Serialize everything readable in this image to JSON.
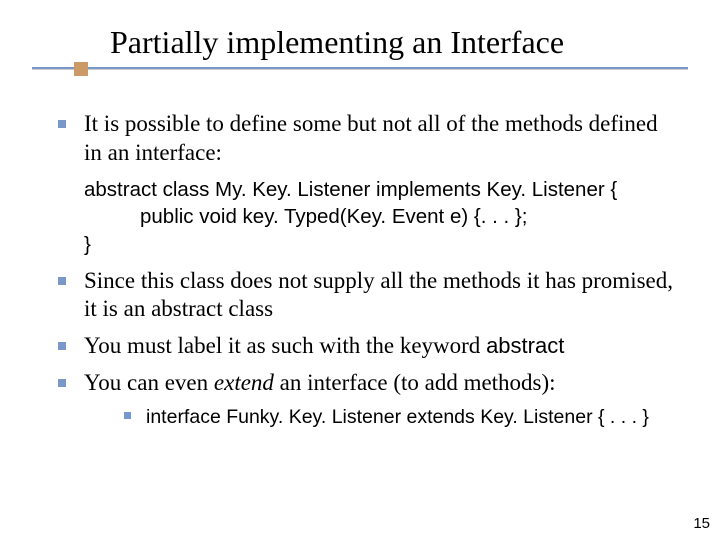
{
  "title": "Partially implementing an Interface",
  "bullets": {
    "b1": "It is possible to define some but not all of the methods defined in an interface:",
    "b2": "Since this class does not supply all the methods it has promised, it is an abstract class",
    "b3_pre": "You must label it as such with the keyword ",
    "b3_kw": "abstract",
    "b4_pre": "You can even ",
    "b4_em": "extend",
    "b4_post": " an interface (to add methods):"
  },
  "code": {
    "l1": "abstract class My. Key. Listener implements Key. Listener {",
    "l2": "public void key. Typed(Key. Event e) {. . . };",
    "l3": "}"
  },
  "sub": {
    "s1": "interface Funky. Key. Listener extends Key. Listener { . . . }"
  },
  "page_number": "15"
}
